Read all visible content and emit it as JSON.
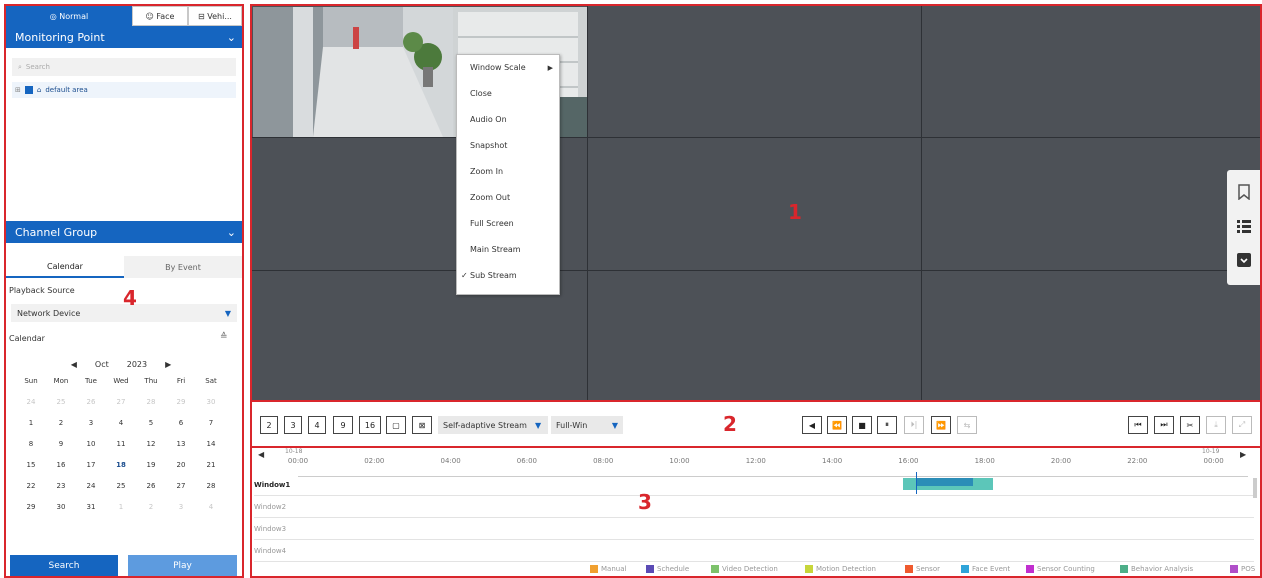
{
  "left_panel": {
    "tabs": [
      {
        "label": "Normal",
        "icon": "target-icon"
      },
      {
        "label": "Face",
        "icon": "face-icon"
      },
      {
        "label": "Vehi...",
        "icon": "vehicle-icon"
      }
    ],
    "monitoring_point": {
      "title": "Monitoring Point",
      "search_placeholder": "Search",
      "tree_item": "default area"
    },
    "channel_group": {
      "title": "Channel Group",
      "subtabs": [
        "Calendar",
        "By Event"
      ],
      "playback_source_label": "Playback Source",
      "playback_source_value": "Network Device",
      "calendar_label": "Calendar",
      "month": "Oct",
      "year": "2023",
      "weekdays": [
        "Sun",
        "Mon",
        "Tue",
        "Wed",
        "Thu",
        "Fri",
        "Sat"
      ],
      "days": [
        "24",
        "25",
        "26",
        "27",
        "28",
        "29",
        "30",
        "1",
        "2",
        "3",
        "4",
        "5",
        "6",
        "7",
        "8",
        "9",
        "10",
        "11",
        "12",
        "13",
        "14",
        "15",
        "16",
        "17",
        "18",
        "19",
        "20",
        "21",
        "22",
        "23",
        "24",
        "25",
        "26",
        "27",
        "28",
        "29",
        "30",
        "31",
        "1",
        "2",
        "3",
        "4"
      ],
      "search_button": "Search",
      "play_button": "Play"
    }
  },
  "context_menu": {
    "items": [
      "Window Scale",
      "Close",
      "Audio On",
      "Snapshot",
      "Zoom In",
      "Zoom Out",
      "Full Screen",
      "Main Stream",
      "Sub Stream"
    ],
    "checked_item": "Sub Stream"
  },
  "toolbar": {
    "layout_buttons": [
      "2",
      "3",
      "4",
      "9",
      "16"
    ],
    "stream_select": "Self-adaptive Stream",
    "window_select": "Full-Win"
  },
  "timeline": {
    "start_date": "10-18",
    "end_date": "10-19",
    "hours": [
      "00:00",
      "02:00",
      "04:00",
      "06:00",
      "08:00",
      "10:00",
      "12:00",
      "14:00",
      "16:00",
      "18:00",
      "20:00",
      "22:00",
      "00:00"
    ],
    "windows": [
      "Window1",
      "Window2",
      "Window3",
      "Window4"
    ],
    "legend": [
      {
        "label": "Manual",
        "color": "#f0a030"
      },
      {
        "label": "Schedule",
        "color": "#5b4bb5"
      },
      {
        "label": "Video Detection",
        "color": "#7dc26b"
      },
      {
        "label": "Motion Detection",
        "color": "#c7d63a"
      },
      {
        "label": "Sensor",
        "color": "#ef5a2e"
      },
      {
        "label": "Face Event",
        "color": "#2fa4d9"
      },
      {
        "label": "Sensor Counting",
        "color": "#c12fcf"
      },
      {
        "label": "Behavior Analysis",
        "color": "#4dae88"
      },
      {
        "label": "POS",
        "color": "#b04fc9"
      }
    ]
  },
  "callouts": [
    "1",
    "2",
    "3",
    "4"
  ],
  "colors": {
    "accent": "#1565c0",
    "highlight": "#d9262c",
    "video_bg": "#4d5157"
  }
}
